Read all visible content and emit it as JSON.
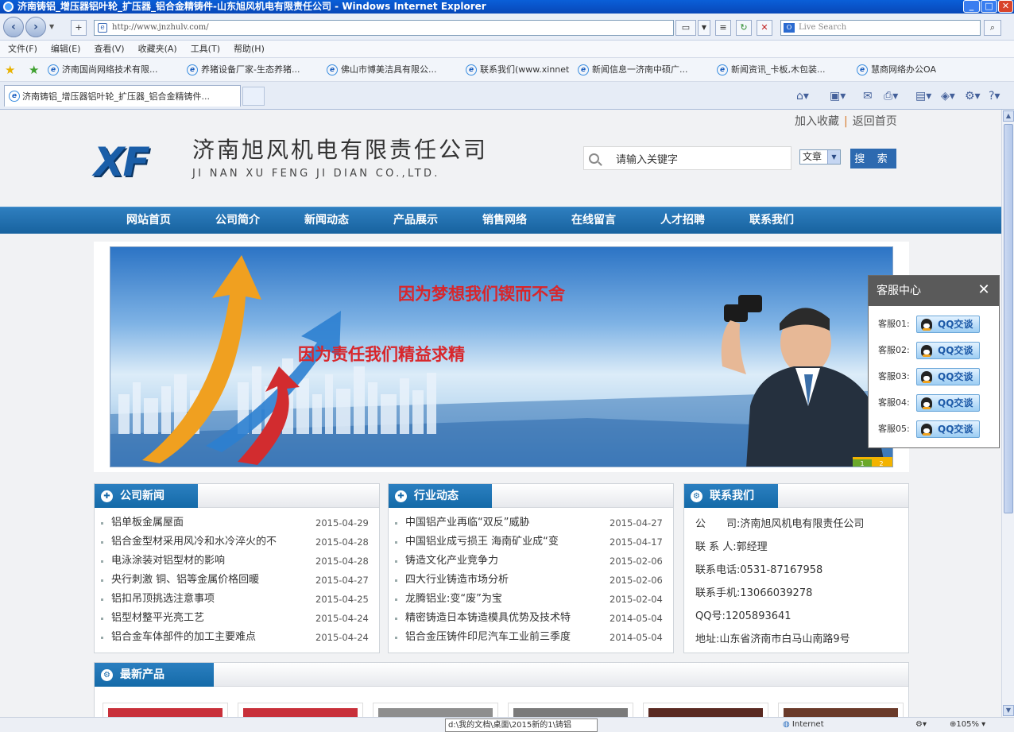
{
  "browser": {
    "title": "济南铸铝_增压器铝叶轮_扩压器_铝合金精铸件-山东旭风机电有限责任公司 - Windows Internet Explorer",
    "address": "http://www.jnzhulv.com/",
    "search_placeholder": "Live Search",
    "menu": [
      "文件(F)",
      "编辑(E)",
      "查看(V)",
      "收藏夹(A)",
      "工具(T)",
      "帮助(H)"
    ],
    "favorites": [
      "济南国尚网络技术有限...",
      "养猪设备厂家-生态养猪...",
      "佛山市博美洁具有限公...",
      "联系我们(www.xinnet",
      "新闻信息一济南中硕广...",
      "新闻资讯_卡板,木包装...",
      "慧商网络办公OA"
    ],
    "tab_title": "济南铸铝_增压器铝叶轮_扩压器_铝合金精铸件...",
    "status_path": "d:\\我的文档\\桌面\\2015新的1\\铸铝",
    "status_zone": "Internet",
    "status_zoom": "105%"
  },
  "site": {
    "top_links": [
      "加入收藏",
      "返回首页"
    ],
    "logo_mark": "XF",
    "company_cn": "济南旭风机电有限责任公司",
    "company_en": "JI NAN XU FENG JI DIAN CO.,LTD.",
    "search_value": "请输入关键字",
    "search_category": "文章",
    "search_button": "搜 索",
    "nav": [
      "网站首页",
      "公司简介",
      "新闻动态",
      "产品展示",
      "销售网络",
      "在线留言",
      "人才招聘",
      "联系我们"
    ],
    "banner": {
      "slogan1": "因为梦想我们锲而不舍",
      "slogan2": "因为责任我们精益求精",
      "dots": [
        "1",
        "2"
      ]
    },
    "kefu": {
      "title": "客服中心",
      "close": "✕",
      "rows": [
        {
          "label": "客服01:",
          "button": "QQ交谈"
        },
        {
          "label": "客服02:",
          "button": "QQ交谈"
        },
        {
          "label": "客服03:",
          "button": "QQ交谈"
        },
        {
          "label": "客服04:",
          "button": "QQ交谈"
        },
        {
          "label": "客服05:",
          "button": "QQ交谈"
        }
      ]
    },
    "company_news": {
      "title": "公司新闻",
      "items": [
        {
          "t": "铝单板金属屋面",
          "d": "2015-04-29"
        },
        {
          "t": "铝合金型材采用风冷和水冷淬火的不",
          "d": "2015-04-28"
        },
        {
          "t": "电泳涂装对铝型材的影响",
          "d": "2015-04-28"
        },
        {
          "t": "央行刺激 铜、铝等金属价格回暖",
          "d": "2015-04-27"
        },
        {
          "t": "铝扣吊顶挑选注意事项",
          "d": "2015-04-25"
        },
        {
          "t": "铝型材整平光亮工艺",
          "d": "2015-04-24"
        },
        {
          "t": "铝合金车体部件的加工主要难点",
          "d": "2015-04-24"
        }
      ]
    },
    "industry_news": {
      "title": "行业动态",
      "items": [
        {
          "t": "中国铝产业再临“双反”威胁",
          "d": "2015-04-27"
        },
        {
          "t": "中国铝业成亏损王 海南矿业成“变",
          "d": "2015-04-17"
        },
        {
          "t": "铸造文化产业竞争力",
          "d": "2015-02-06"
        },
        {
          "t": "四大行业铸造市场分析",
          "d": "2015-02-06"
        },
        {
          "t": "龙腾铝业:变“废”为宝",
          "d": "2015-02-04"
        },
        {
          "t": "精密铸造日本铸造模具优势及技术特",
          "d": "2014-05-04"
        },
        {
          "t": "铝合金压铸件印尼汽车工业前三季度",
          "d": "2014-05-04"
        }
      ]
    },
    "contact": {
      "title": "联系我们",
      "lines": [
        "公　　司:济南旭风机电有限责任公司",
        "联 系 人:郭经理",
        "联系电话:0531-87167958",
        "联系手机:13066039278",
        "QQ号:1205893641",
        "地址:山东省济南市白马山南路9号"
      ]
    },
    "products": {
      "title": "最新产品"
    }
  },
  "colors": {
    "nav_blue": "#1a6aa8",
    "slogan_red": "#d8262b",
    "accent_orange": "#f3b300"
  }
}
